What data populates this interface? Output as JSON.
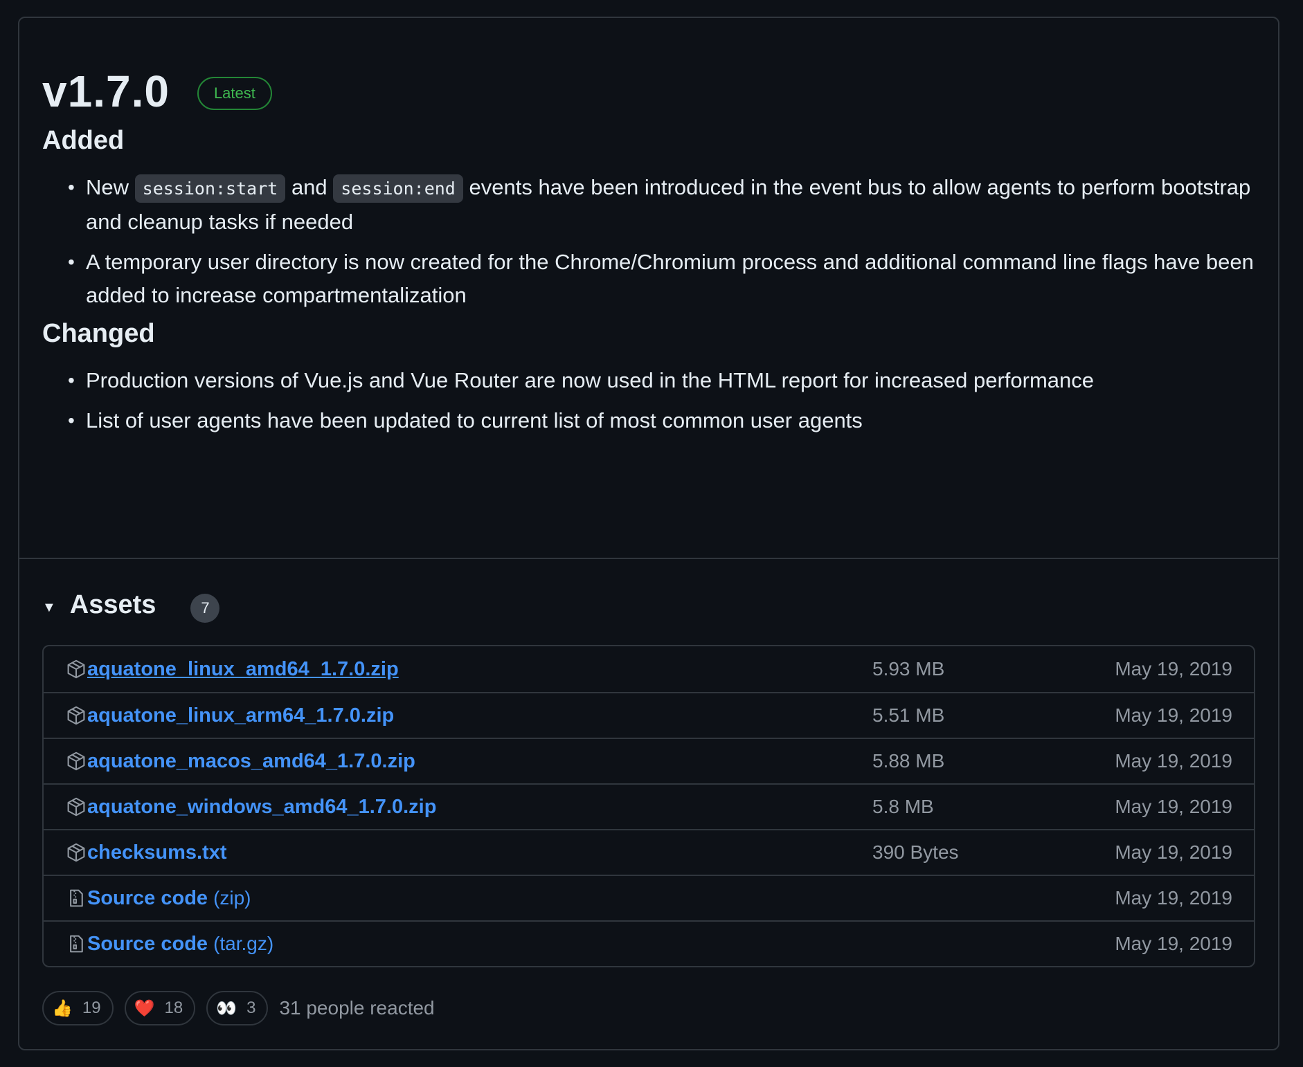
{
  "release": {
    "version": "v1.7.0",
    "badge": "Latest"
  },
  "sections": {
    "added": {
      "heading": "Added",
      "item1": {
        "pre": "New",
        "code1": "session:start",
        "mid": "and",
        "code2": "session:end",
        "post": "events have been introduced in the event bus to allow agents to perform bootstrap and cleanup tasks if needed"
      },
      "item2": "A temporary user directory is now created for the Chrome/Chromium process and additional command line flags have been added to increase compartmentalization"
    },
    "changed": {
      "heading": "Changed",
      "items": [
        "Production versions of Vue.js and Vue Router are now used in the HTML report for increased performance",
        "List of user agents have been updated to current list of most common user agents"
      ]
    }
  },
  "assets": {
    "title": "Assets",
    "count": "7",
    "items": [
      {
        "name": "aquatone_linux_amd64_1.7.0.zip",
        "ext": "",
        "size": "5.93 MB",
        "date": "May 19, 2019",
        "icon": "package-icon"
      },
      {
        "name": "aquatone_linux_arm64_1.7.0.zip",
        "ext": "",
        "size": "5.51 MB",
        "date": "May 19, 2019",
        "icon": "package-icon"
      },
      {
        "name": "aquatone_macos_amd64_1.7.0.zip",
        "ext": "",
        "size": "5.88 MB",
        "date": "May 19, 2019",
        "icon": "package-icon"
      },
      {
        "name": "aquatone_windows_amd64_1.7.0.zip",
        "ext": "",
        "size": "5.8 MB",
        "date": "May 19, 2019",
        "icon": "package-icon"
      },
      {
        "name": "checksums.txt",
        "ext": "",
        "size": "390 Bytes",
        "date": "May 19, 2019",
        "icon": "package-icon"
      },
      {
        "name": "Source code",
        "ext": "(zip)",
        "size": "",
        "date": "May 19, 2019",
        "icon": "file-zip-icon"
      },
      {
        "name": "Source code",
        "ext": "(tar.gz)",
        "size": "",
        "date": "May 19, 2019",
        "icon": "file-zip-icon"
      }
    ]
  },
  "reactions": {
    "thumbs_up": {
      "emoji": "👍",
      "count": "19"
    },
    "heart": {
      "emoji": "❤️",
      "count": "18"
    },
    "eyes": {
      "emoji": "👀",
      "count": "3"
    },
    "summary": "31 people reacted"
  },
  "colors": {
    "background": "#0d1117",
    "link": "#4493f8",
    "badge_green": "#3fb950",
    "border": "#30363d"
  }
}
